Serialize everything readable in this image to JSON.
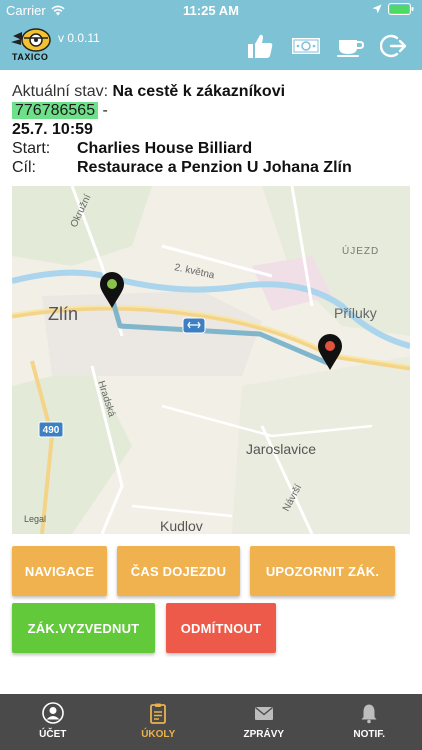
{
  "statusbar": {
    "carrier": "Carrier",
    "time": "11:25 AM"
  },
  "app": {
    "logo_text": "TAXICO",
    "version": "v 0.0.11"
  },
  "nav_icons": [
    "thumbs-up-icon",
    "money-icon",
    "coffee-cup-icon",
    "logout-icon"
  ],
  "order": {
    "status_label": "Aktuální stav:",
    "status_value": "Na cestě k zákazníkovi",
    "phone": "776786565",
    "separator": "-",
    "datetime": "25.7. 10:59",
    "start_label": "Start:",
    "start_value": "Charlies House Billiard",
    "dest_label": "Cíl:",
    "dest_value": "Restaurace a Penzion U Johana Zlín"
  },
  "map": {
    "labels": {
      "zlin": "Zlín",
      "priluky": "Příluky",
      "ujezd": "ÚJEZD",
      "jaroslavice": "Jaroslavice",
      "kudlov": "Kudlov",
      "okruzni": "Okružní",
      "kvetna": "2. května",
      "hradska": "Hradská",
      "navrsi": "Návrší",
      "road_490": "490",
      "legal": "Legal"
    }
  },
  "buttons": {
    "navigace": "NAVIGACE",
    "cas": "ČAS DOJEZDU",
    "upozornit": "UPOZORNIT ZÁK.",
    "vyzvednut": "ZÁK.VYZVEDNUT",
    "odmitnout": "ODMÍTNOUT"
  },
  "colors": {
    "header": "#7ec2d6",
    "orange": "#f0b24f",
    "green": "#61c93a",
    "red": "#ed5a49",
    "tabbar": "#4a4a4a",
    "tab_active": "#e9b24e"
  },
  "tabs": [
    {
      "label": "ÚČET",
      "icon": "user-icon"
    },
    {
      "label": "ÚKOLY",
      "icon": "clipboard-icon",
      "active": true
    },
    {
      "label": "ZPRÁVY",
      "icon": "envelope-icon"
    },
    {
      "label": "NOTIF.",
      "icon": "bell-icon"
    }
  ]
}
